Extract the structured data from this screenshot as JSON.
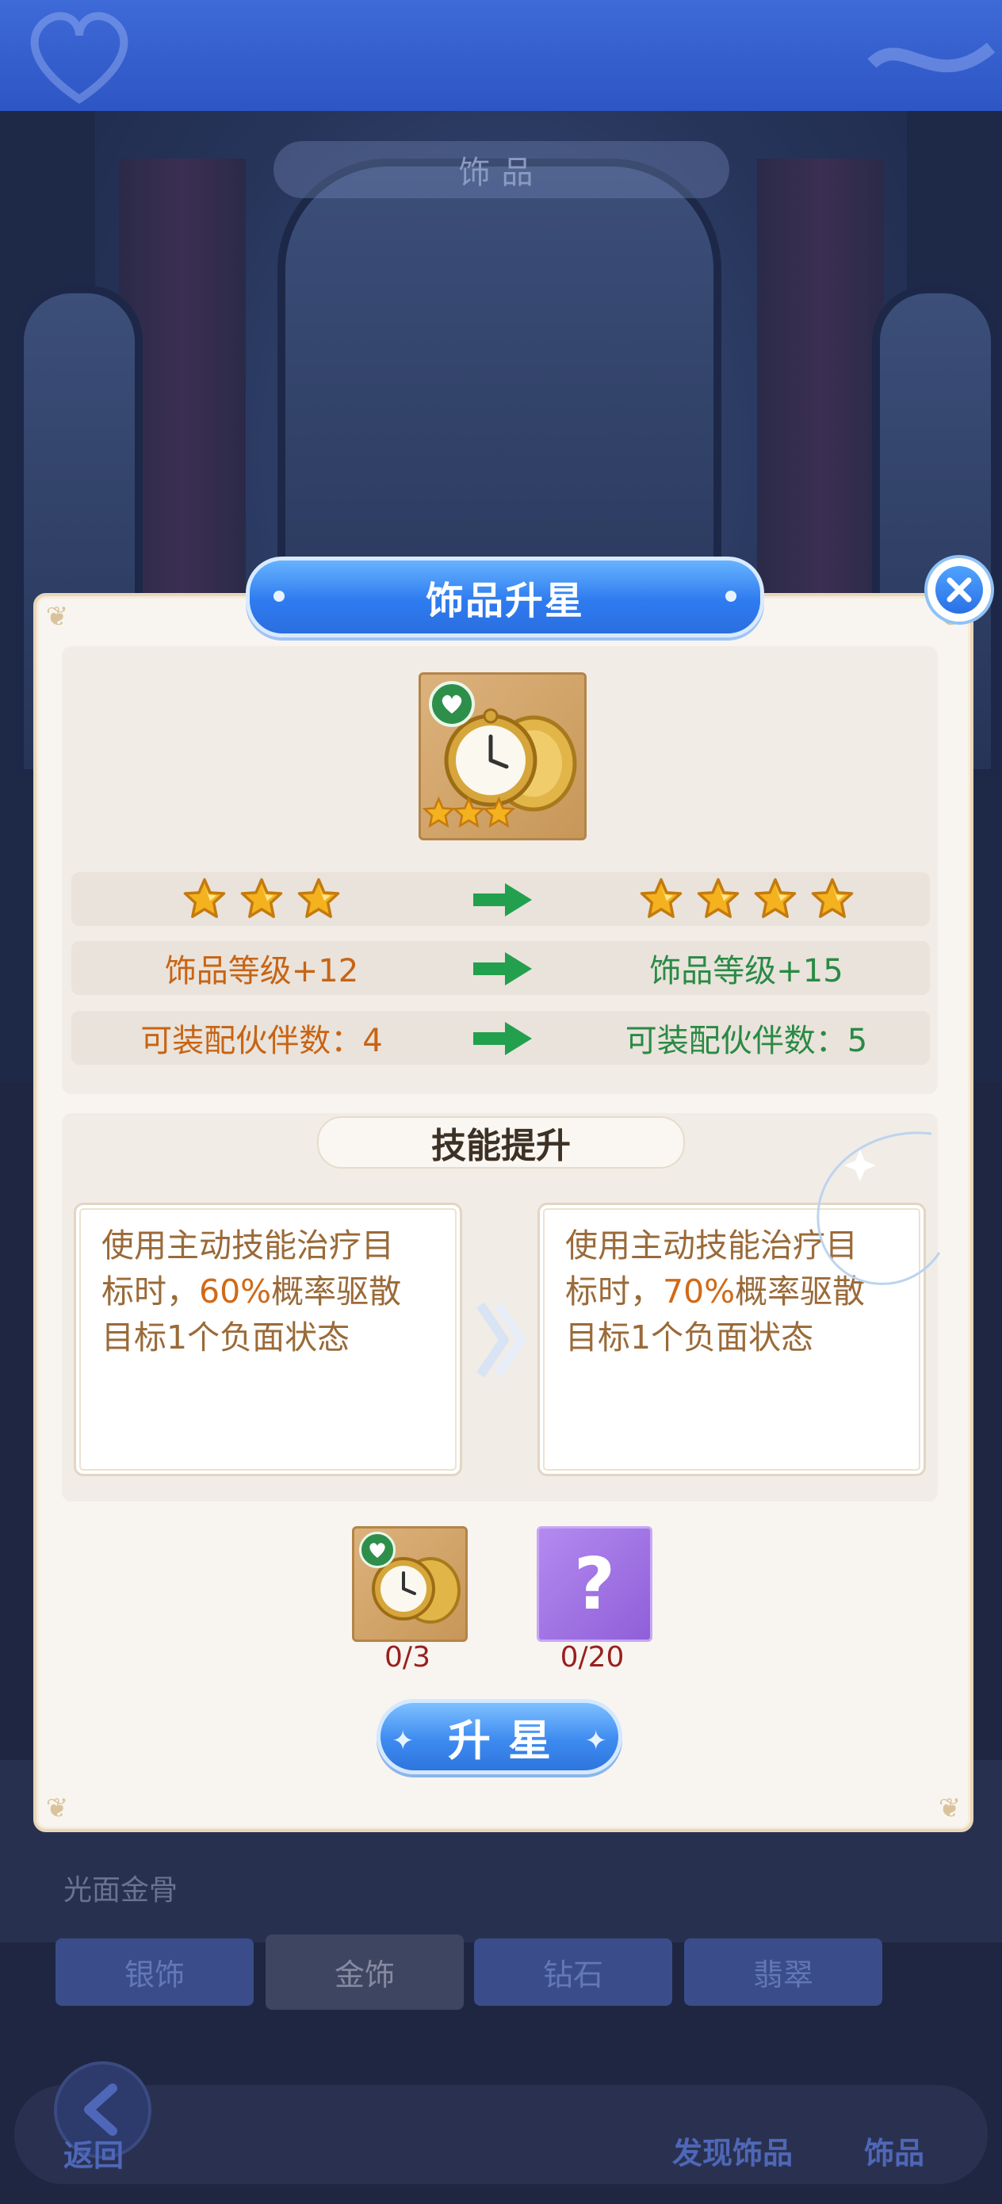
{
  "background": {
    "scene_title": "饰品",
    "item_name": "光面金骨",
    "category_tabs": [
      "银饰",
      "金饰",
      "钻石",
      "翡翠"
    ],
    "active_tab": "金饰",
    "nav": {
      "back": "返回",
      "discover": "发现饰品",
      "accessory": "饰品"
    }
  },
  "modal": {
    "title": "饰品升星",
    "close_icon": "close-icon",
    "item": {
      "icon": "pocket-watch-icon",
      "badge": "heart-badge-icon",
      "stars": 3
    },
    "upgrade": {
      "stars_before": 3,
      "stars_after": 4,
      "level_before": "饰品等级+12",
      "level_after": "饰品等级+15",
      "partners_before": "可装配伙伴数：4",
      "partners_after": "可装配伙伴数：5"
    },
    "skill": {
      "title": "技能提升",
      "before": {
        "line1": "使用主动技能治疗目",
        "line2a": "标时，",
        "rate": "60%",
        "line2b": "概率驱散",
        "line3": "目标1个负面状态"
      },
      "after": {
        "line1": "使用主动技能治疗目",
        "line2a": "标时，",
        "rate": "70%",
        "line2b": "概率驱散",
        "line3": "目标1个负面状态"
      }
    },
    "materials": [
      {
        "icon": "pocket-watch-icon",
        "count": "0/3"
      },
      {
        "icon": "question-mark-icon",
        "symbol": "?",
        "count": "0/20"
      }
    ],
    "button": "升星",
    "colors": {
      "level_before": "#c86414",
      "level_after": "#2a8a45",
      "arrow": "#22a04e",
      "star": "#f4b21e",
      "title_blue": "#2e7bf0"
    }
  }
}
